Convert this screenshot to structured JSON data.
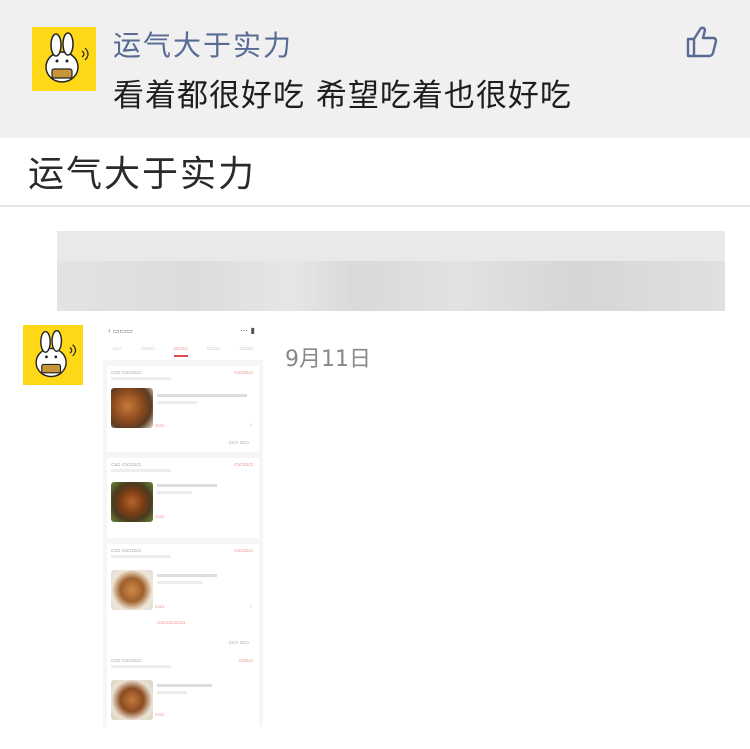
{
  "comment": {
    "name": "运气大于实力",
    "text": "看着都很好吃 希望吃着也很好吃",
    "avatar_icon": "rabbit-avatar-icon",
    "like_icon": "thumbs-up-icon"
  },
  "section": {
    "title": "运气大于实力"
  },
  "post": {
    "date": "9月11日",
    "avatar_icon": "rabbit-avatar-icon",
    "image_icon": "order-list-screenshot"
  },
  "colors": {
    "name_link": "#576b95",
    "avatar_bg": "#ffd818",
    "header_bg": "#f0f0f0",
    "accent_red": "#e04a4a"
  }
}
